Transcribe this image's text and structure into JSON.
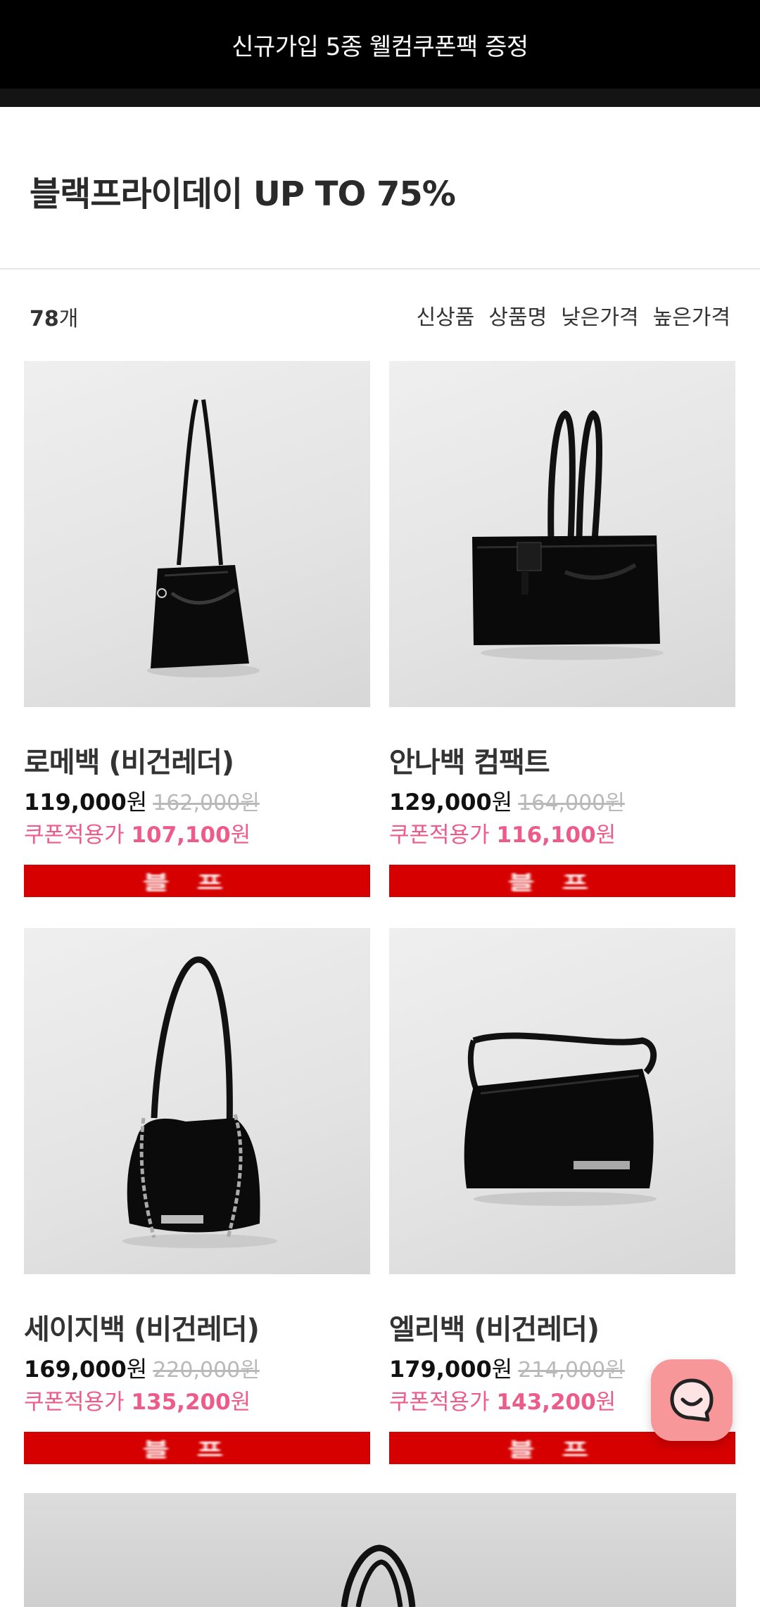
{
  "top_banner": {
    "text": "신규가입 5종 웰컴쿠폰팩 증정"
  },
  "page": {
    "title": "블랙프라이데이 UP TO 75%"
  },
  "list_meta": {
    "count": "78",
    "count_unit": "개"
  },
  "sort_options": [
    "신상품",
    "상품명",
    "낮은가격",
    "높은가격"
  ],
  "products": [
    {
      "name": "로메백 (비건레더)",
      "price": "119,000",
      "price_unit": "원",
      "original_price": "162,000원",
      "coupon_label": "쿠폰적용가",
      "coupon_price": "107,100",
      "coupon_unit": "원",
      "badge": "블프",
      "image": "tote-bag-tall"
    },
    {
      "name": "안나백 컴팩트",
      "price": "129,000",
      "price_unit": "원",
      "original_price": "164,000원",
      "coupon_label": "쿠폰적용가",
      "coupon_price": "116,100",
      "coupon_unit": "원",
      "badge": "블프",
      "image": "tote-bag-wide"
    },
    {
      "name": "세이지백 (비건레더)",
      "price": "169,000",
      "price_unit": "원",
      "original_price": "220,000원",
      "coupon_label": "쿠폰적용가",
      "coupon_price": "135,200",
      "coupon_unit": "원",
      "badge": "블프",
      "image": "chain-hobo-bag"
    },
    {
      "name": "엘리백 (비건레더)",
      "price": "179,000",
      "price_unit": "원",
      "original_price": "214,000원",
      "coupon_label": "쿠폰적용가",
      "coupon_price": "143,200",
      "coupon_unit": "원",
      "badge": "블프",
      "image": "flap-shoulder-bag"
    }
  ],
  "colors": {
    "topbar": "#000000",
    "coupon": "#ec5b8a",
    "badge": "#d60000",
    "chat": "#f7979a"
  },
  "chat_button": {
    "icon": "chat-bubble-icon"
  }
}
